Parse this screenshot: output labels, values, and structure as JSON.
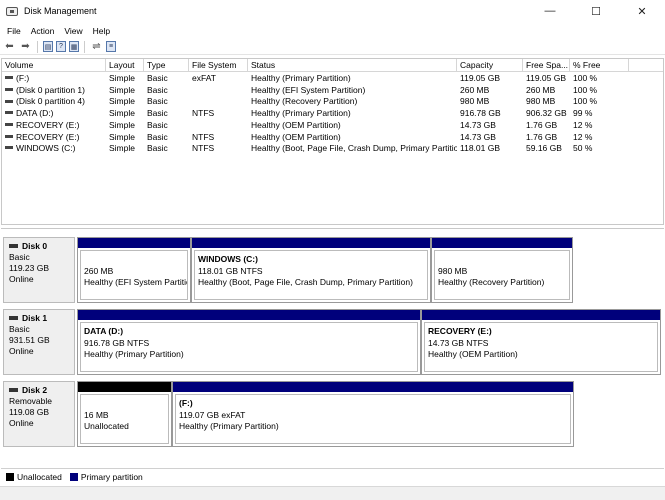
{
  "window": {
    "title": "Disk Management",
    "minimize": "—",
    "maximize": "☐",
    "close": "✕"
  },
  "menu": [
    "File",
    "Action",
    "View",
    "Help"
  ],
  "toolbar": {
    "help_label": "?"
  },
  "volume_list": {
    "columns": [
      "Volume",
      "Layout",
      "Type",
      "File System",
      "Status",
      "Capacity",
      "Free Spa...",
      "% Free"
    ],
    "rows": [
      [
        "(F:)",
        "Simple",
        "Basic",
        "exFAT",
        "Healthy (Primary Partition)",
        "119.05 GB",
        "119.05 GB",
        "100 %"
      ],
      [
        "(Disk 0 partition 1)",
        "Simple",
        "Basic",
        "",
        "Healthy (EFI System Partition)",
        "260 MB",
        "260 MB",
        "100 %"
      ],
      [
        "(Disk 0 partition 4)",
        "Simple",
        "Basic",
        "",
        "Healthy (Recovery Partition)",
        "980 MB",
        "980 MB",
        "100 %"
      ],
      [
        "DATA (D:)",
        "Simple",
        "Basic",
        "NTFS",
        "Healthy (Primary Partition)",
        "916.78 GB",
        "906.32 GB",
        "99 %"
      ],
      [
        "RECOVERY (E:)",
        "Simple",
        "Basic",
        "",
        "Healthy (OEM Partition)",
        "14.73 GB",
        "1.76 GB",
        "12 %"
      ],
      [
        "RECOVERY (E:)",
        "Simple",
        "Basic",
        "NTFS",
        "Healthy (OEM Partition)",
        "14.73 GB",
        "1.76 GB",
        "12 %"
      ],
      [
        "WINDOWS (C:)",
        "Simple",
        "Basic",
        "NTFS",
        "Healthy (Boot, Page File, Crash Dump, Primary Partition)",
        "118.01 GB",
        "59.16 GB",
        "50 %"
      ]
    ]
  },
  "disks": [
    {
      "name": "Disk 0",
      "type": "Basic",
      "size": "119.23 GB",
      "state": "Online",
      "partitions": [
        {
          "title": "",
          "size": "260 MB",
          "status": "Healthy (EFI System Partition)",
          "kind": "primary"
        },
        {
          "title": "WINDOWS  (C:)",
          "size": "118.01 GB NTFS",
          "status": "Healthy (Boot, Page File, Crash Dump, Primary Partition)",
          "kind": "primary"
        },
        {
          "title": "",
          "size": "980 MB",
          "status": "Healthy (Recovery Partition)",
          "kind": "primary"
        }
      ]
    },
    {
      "name": "Disk 1",
      "type": "Basic",
      "size": "931.51 GB",
      "state": "Online",
      "partitions": [
        {
          "title": "DATA  (D:)",
          "size": "916.78 GB NTFS",
          "status": "Healthy (Primary Partition)",
          "kind": "primary"
        },
        {
          "title": "RECOVERY  (E:)",
          "size": "14.73 GB NTFS",
          "status": "Healthy (OEM Partition)",
          "kind": "primary"
        }
      ]
    },
    {
      "name": "Disk 2",
      "type": "Removable",
      "size": "119.08 GB",
      "state": "Online",
      "partitions": [
        {
          "title": "",
          "size": "16 MB",
          "status": "Unallocated",
          "kind": "unallocated"
        },
        {
          "title": "(F:)",
          "size": "119.07 GB exFAT",
          "status": "Healthy (Primary Partition)",
          "kind": "primary"
        }
      ]
    }
  ],
  "legend": [
    {
      "label": "Unallocated",
      "color": "#000000"
    },
    {
      "label": "Primary partition",
      "color": "#00007b"
    }
  ]
}
